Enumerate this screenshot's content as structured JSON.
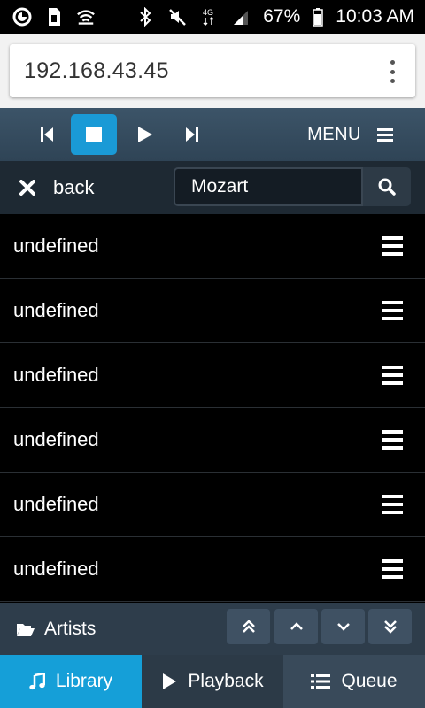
{
  "status_bar": {
    "battery": "67%",
    "time": "10:03 AM",
    "icons": [
      "circle-logo-icon",
      "sim-icon",
      "wifi-icon",
      "bluetooth-icon",
      "mute-icon",
      "lte-icon",
      "signal-icon",
      "battery-icon"
    ]
  },
  "browser": {
    "url": "192.168.43.45",
    "menu_icon": "kebab-menu-icon"
  },
  "player": {
    "menu_label": "MENU",
    "active_control": "stop"
  },
  "search": {
    "back_label": "back",
    "query": "Mozart"
  },
  "list": {
    "items": [
      {
        "label": "undefined"
      },
      {
        "label": "undefined"
      },
      {
        "label": "undefined"
      },
      {
        "label": "undefined"
      },
      {
        "label": "undefined"
      },
      {
        "label": "undefined"
      }
    ]
  },
  "footer": {
    "section_label": "Artists"
  },
  "tabs": [
    {
      "label": "Library",
      "icon": "music-note-icon",
      "active": true
    },
    {
      "label": "Playback",
      "icon": "play-icon",
      "active": false
    },
    {
      "label": "Queue",
      "icon": "list-icon",
      "active": false
    }
  ],
  "colors": {
    "accent": "#159fd8",
    "toolbar": "#34495c",
    "search_row": "#1e2933",
    "list_bg": "#000000"
  }
}
